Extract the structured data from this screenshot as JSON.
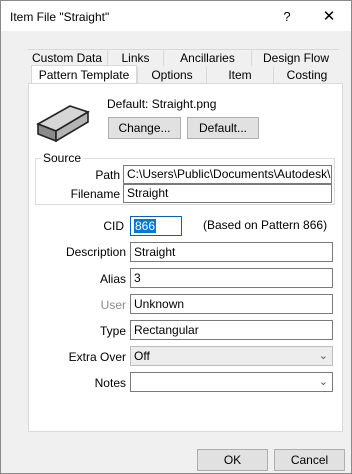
{
  "window": {
    "title": "Item File \"Straight\"",
    "help_glyph": "?",
    "close_glyph": "✕"
  },
  "tabs_back": [
    "Custom Data",
    "Links",
    "Ancillaries",
    "Design Flow"
  ],
  "tabs_front": [
    "Pattern Template",
    "Options",
    "Item",
    "Costing"
  ],
  "selected_tab": "Pattern Template",
  "preview": {
    "default_label": "Default: Straight.png",
    "change_button": "Change...",
    "default_button": "Default...",
    "icon": "duct-straight-icon"
  },
  "source": {
    "legend": "Source",
    "path_label": "Path",
    "path_value": "C:\\Users\\Public\\Documents\\Autodesk\\Fa",
    "filename_label": "Filename",
    "filename_value": "Straight"
  },
  "fields": {
    "cid_label": "CID",
    "cid_value": "866",
    "cid_note": "(Based on Pattern 866)",
    "description_label": "Description",
    "description_value": "Straight",
    "alias_label": "Alias",
    "alias_value": "3",
    "user_label": "User",
    "user_value": "Unknown",
    "type_label": "Type",
    "type_value": "Rectangular",
    "extra_over_label": "Extra Over",
    "extra_over_value": "Off",
    "notes_label": "Notes",
    "notes_value": ""
  },
  "buttons": {
    "ok": "OK",
    "cancel": "Cancel"
  },
  "colors": {
    "selection": "#0078d7",
    "panel": "#ffffff",
    "dialog": "#f0f0f0"
  }
}
